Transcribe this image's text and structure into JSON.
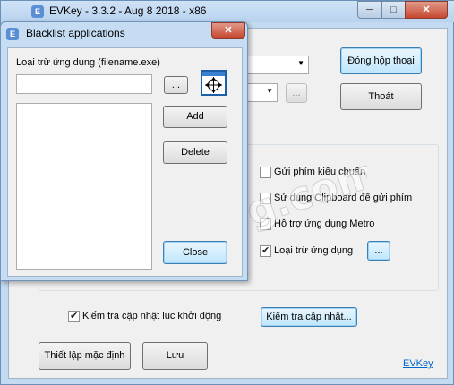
{
  "main": {
    "title": "EVKey - 3.3.2 - Aug  8 2018 - x86",
    "app_icon": "evkey-icon",
    "window_buttons": {
      "minimize": "─",
      "maximize": "□",
      "close": "✕"
    },
    "buttons": {
      "close_dialog": "Đóng hộp thoại",
      "exit": "Thoát",
      "more_dots": "...",
      "check_update": "Kiểm tra cập nhật...",
      "defaults": "Thiết lập mặc định",
      "save": "Lưu"
    },
    "options": [
      {
        "label": "Gửi phím kiểu chuẩn",
        "checked": false
      },
      {
        "label": "Sử dụng Clipboard để gửi phím",
        "checked": false
      },
      {
        "label": "Hỗ trợ ứng dụng Metro",
        "checked": false
      },
      {
        "label": "Loại trừ ứng dụng",
        "checked": true
      }
    ],
    "exclude_apps_button": "...",
    "startup_update": {
      "label": "Kiểm tra cập nhật lúc khởi động",
      "checked": true
    },
    "footer_link": "EVKey"
  },
  "blacklist": {
    "title": "Blacklist applications",
    "close_x": "✕",
    "field_label": "Loại trừ ứng dụng (filename.exe)",
    "input_value": "",
    "browse_button": "...",
    "picker_icon": "crosshair-target-icon",
    "list_items": [],
    "buttons": {
      "add": "Add",
      "delete": "Delete",
      "close": "Close"
    }
  },
  "watermark": {
    "text": "Sofsog.com"
  },
  "colors": {
    "desktop": "#4a8fd0",
    "window_frame": "#c4daf0",
    "client": "#f0f0f0",
    "focus_border": "#3c7fb1",
    "link": "#0066cc",
    "close_red": "#c6482f"
  }
}
